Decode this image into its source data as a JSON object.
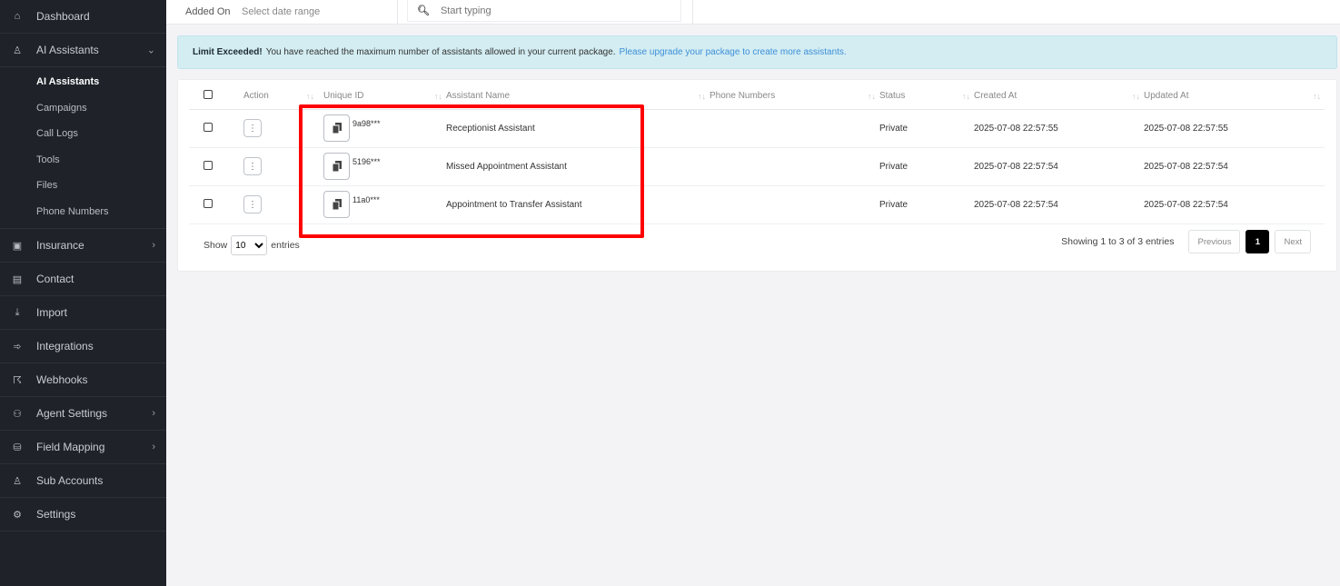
{
  "sidebar": {
    "items": [
      {
        "label": "Dashboard",
        "icon": "home-icon"
      },
      {
        "label": "AI Assistants",
        "icon": "user-icon",
        "expanded": true
      },
      {
        "label": "Insurance",
        "icon": "id-card-icon"
      },
      {
        "label": "Contact",
        "icon": "contact-card-icon"
      },
      {
        "label": "Import",
        "icon": "download-icon"
      },
      {
        "label": "Integrations",
        "icon": "plug-icon"
      },
      {
        "label": "Webhooks",
        "icon": "webhook-icon"
      },
      {
        "label": "Agent Settings",
        "icon": "users-icon"
      },
      {
        "label": "Field Mapping",
        "icon": "database-icon"
      },
      {
        "label": "Sub Accounts",
        "icon": "user-icon"
      },
      {
        "label": "Settings",
        "icon": "gear-icon"
      }
    ],
    "sub_items": [
      "AI Assistants",
      "Campaigns",
      "Call Logs",
      "Tools",
      "Files",
      "Phone Numbers"
    ]
  },
  "filters": {
    "added_on_label": "Added On",
    "date_placeholder": "Select date range",
    "search_placeholder": "Start typing"
  },
  "alert": {
    "title": "Limit Exceeded!",
    "message": "You have reached the maximum number of assistants allowed in your current package.",
    "link": "Please upgrade your package to create more assistants."
  },
  "table": {
    "headers": [
      "Action",
      "Unique ID",
      "Assistant Name",
      "Phone Numbers",
      "Status",
      "Created At",
      "Updated At"
    ],
    "rows": [
      {
        "uid": "9a98***",
        "name": "Receptionist Assistant",
        "phone": "",
        "status": "Private",
        "created": "2025-07-08 22:57:55",
        "updated": "2025-07-08 22:57:55"
      },
      {
        "uid": "5196***",
        "name": "Missed Appointment Assistant",
        "phone": "",
        "status": "Private",
        "created": "2025-07-08 22:57:54",
        "updated": "2025-07-08 22:57:54"
      },
      {
        "uid": "11a0***",
        "name": "Appointment to Transfer Assistant",
        "phone": "",
        "status": "Private",
        "created": "2025-07-08 22:57:54",
        "updated": "2025-07-08 22:57:54"
      }
    ]
  },
  "footer": {
    "show_label": "Show",
    "page_size": "10",
    "entries_label": "entries",
    "info": "Showing 1 to 3 of 3 entries",
    "previous": "Previous",
    "current_page": "1",
    "next": "Next"
  },
  "colors": {
    "sidebar_bg": "#1f2329",
    "alert_bg": "#d3edf2",
    "link": "#3f8fd8",
    "highlight": "#ff0000"
  }
}
